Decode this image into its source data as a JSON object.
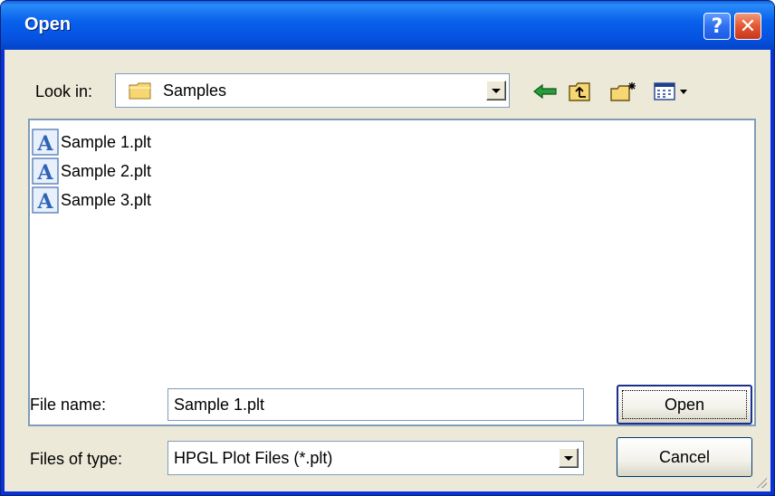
{
  "window": {
    "title": "Open",
    "help_label": "?",
    "close_label": "✕"
  },
  "look_in": {
    "label": "Look in:",
    "value": "Samples",
    "icon": "folder-icon"
  },
  "toolbar": {
    "icons": [
      "back-icon",
      "up-folder-icon",
      "new-folder-icon",
      "views-menu-icon"
    ]
  },
  "files": [
    {
      "name": "Sample 1.plt",
      "icon": "plt-file-icon"
    },
    {
      "name": "Sample 2.plt",
      "icon": "plt-file-icon"
    },
    {
      "name": "Sample 3.plt",
      "icon": "plt-file-icon"
    }
  ],
  "file_name": {
    "label": "File name:",
    "value": "Sample 1.plt"
  },
  "file_type": {
    "label": "Files of type:",
    "value": "HPGL Plot Files (*.plt)"
  },
  "buttons": {
    "open": "Open",
    "cancel": "Cancel"
  },
  "colors": {
    "titlebar": "#0a5fec",
    "dialog_bg": "#ece9d8",
    "close_button": "#e3572f"
  }
}
